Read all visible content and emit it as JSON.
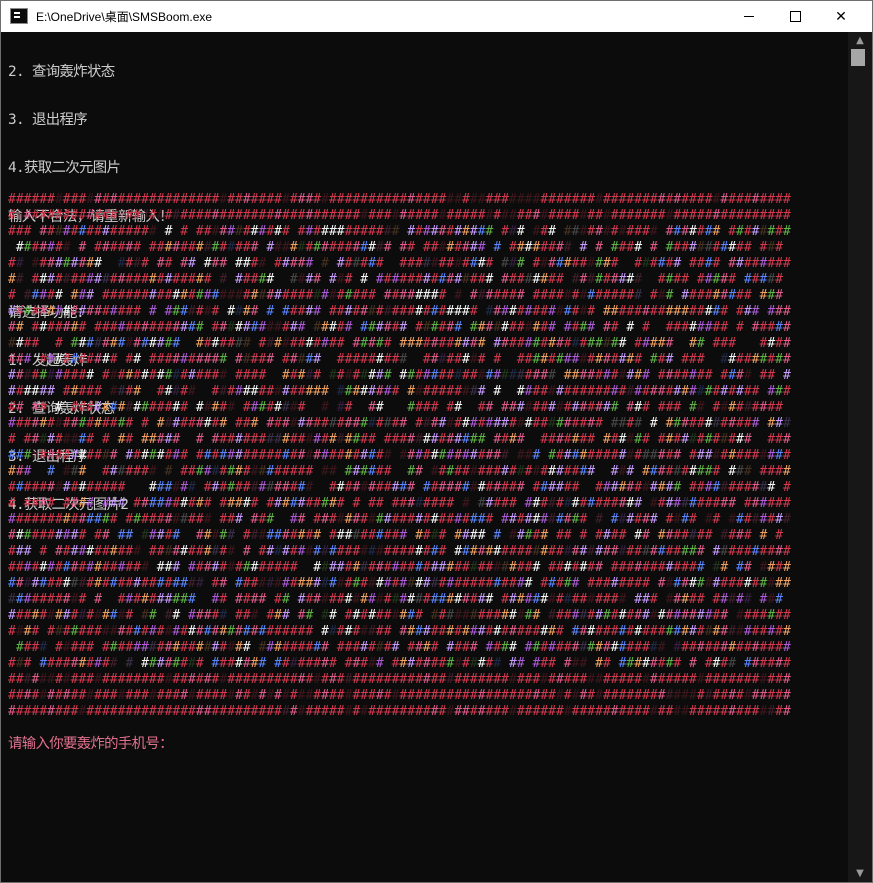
{
  "window": {
    "title": "E:\\OneDrive\\桌面\\SMSBoom.exe",
    "minimize_glyph": "—",
    "maximize_glyph": "☐",
    "close_glyph": "✕"
  },
  "console": {
    "lines": [
      "2. 查询轰炸状态",
      "3. 退出程序",
      "4.获取二次元图片",
      "输入不合法，请重新输入！",
      "",
      "请选择功能：",
      "1. 发起轰炸",
      "2. 查询轰炸状态",
      "3. 退出程序",
      "4.获取二次元图片2"
    ],
    "prompt": "请输入你要轰炸的手机号："
  },
  "art": {
    "char": "#",
    "rows": 33,
    "cols": 100,
    "colors": [
      "#d2394f",
      "#e05b8a",
      "#c79bff",
      "#f2a060",
      "#f6f6f6",
      "#5fb347",
      "#5c86ff",
      "#ae5bd8"
    ]
  },
  "scrollbar": {
    "up_glyph": "▲",
    "down_glyph": "▼"
  }
}
